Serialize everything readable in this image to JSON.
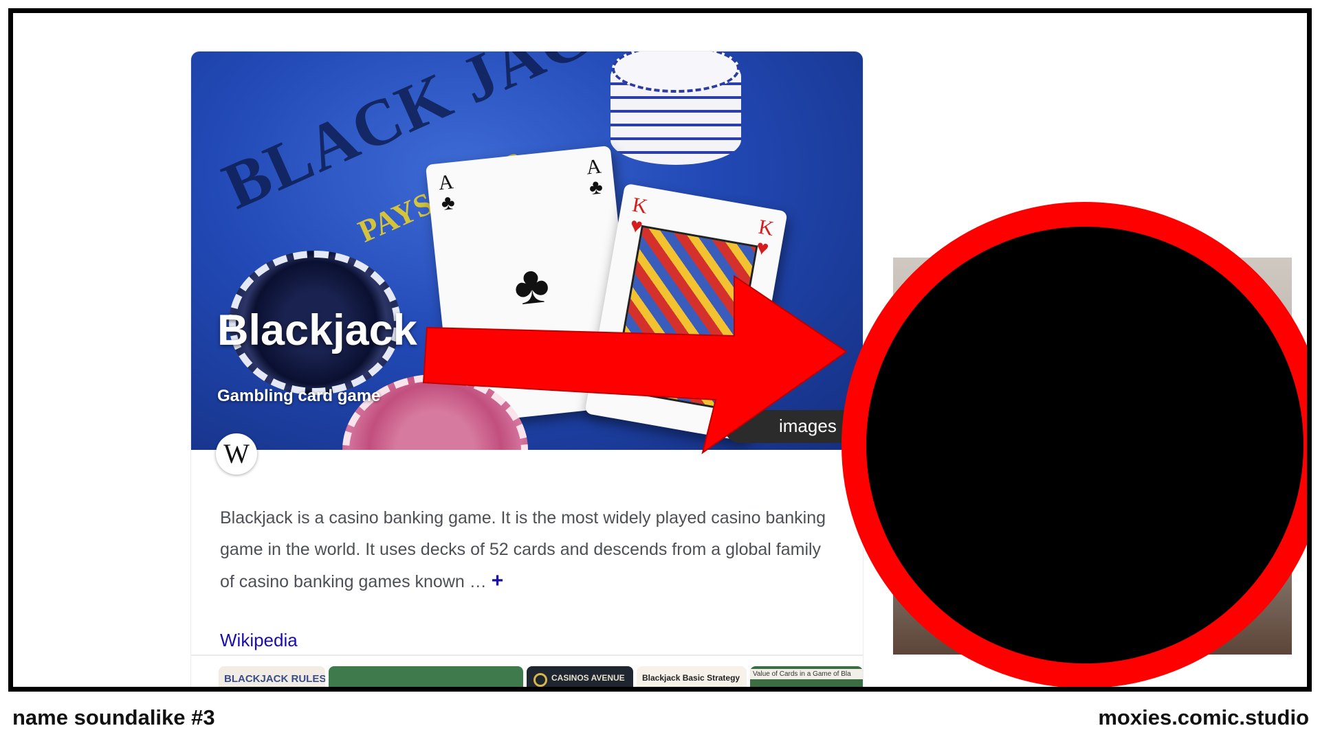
{
  "knowledge_panel": {
    "title": "Blackjack",
    "subtitle": "Gambling card game",
    "more_images_label": "images",
    "description": "Blackjack is a casino banking game. It is the most widely played casino banking game in the world. It uses decks of 52 cards and descends from a global family of casino banking games known …",
    "expand_symbol": "+",
    "source_link": "Wikipedia",
    "source_icon": "W"
  },
  "hero_image": {
    "felt_text": "BLACK JACK",
    "felt_sub": "PAYS 3 TO 2",
    "ace_rank": "A",
    "ace_suit": "♣",
    "king_rank": "K",
    "king_suit": "♥"
  },
  "thumbnails": [
    {
      "label": "BLACKJACK RULES"
    },
    {
      "label": ""
    },
    {
      "label": "CASINOS AVENUE"
    },
    {
      "label": "Blackjack Basic Strategy"
    },
    {
      "label": "Value of Cards in a Game of Bla"
    }
  ],
  "caption": {
    "left": "name soundalike #3",
    "right": "moxies.comic.studio"
  },
  "colors": {
    "arrow": "#ff0000",
    "ring": "#ff0000",
    "link": "#1a0dab"
  }
}
